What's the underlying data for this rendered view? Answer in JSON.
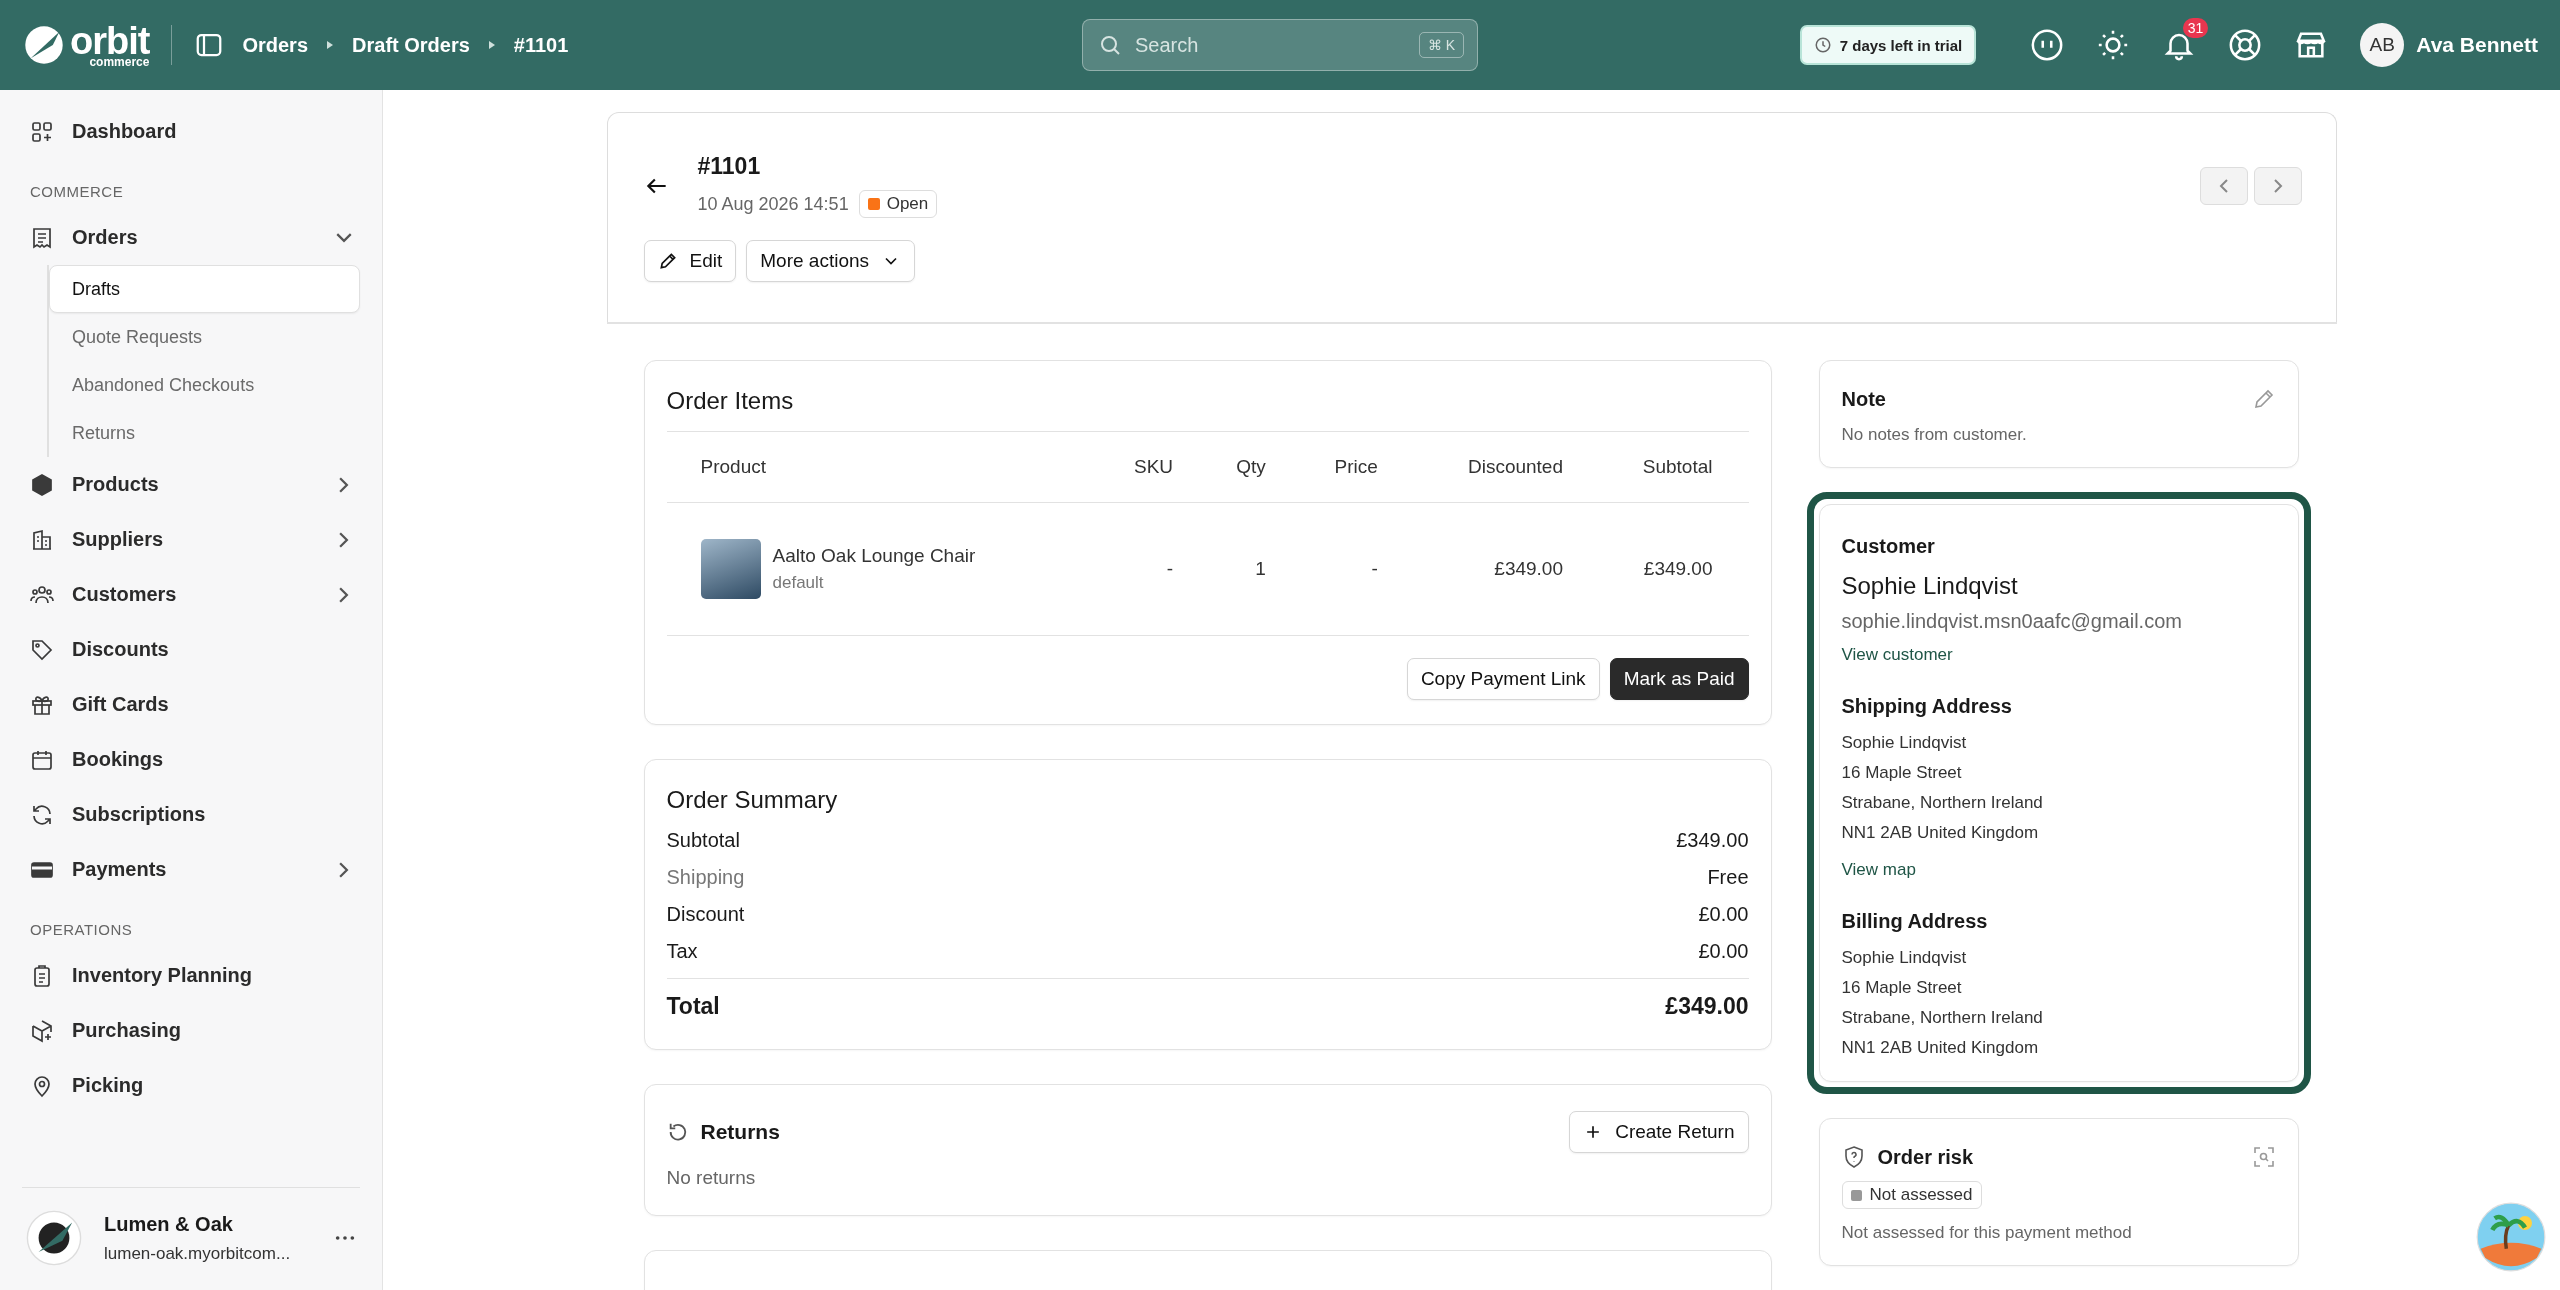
{
  "topbar": {
    "logo": {
      "word": "orbit",
      "sub": "commerce"
    },
    "breadcrumbs": [
      "Orders",
      "Draft Orders",
      "#1101"
    ],
    "search": {
      "placeholder": "Search",
      "shortcut": "⌘ K"
    },
    "trial": "7 days left in trial",
    "notifications": "31",
    "user": {
      "initials": "AB",
      "name": "Ava Bennett"
    }
  },
  "sidebar": {
    "items": [
      {
        "kind": "link",
        "label": "Dashboard"
      },
      {
        "kind": "section",
        "label": "COMMERCE"
      },
      {
        "kind": "link",
        "label": "Orders",
        "expanded": true,
        "children": [
          {
            "label": "Drafts",
            "selected": true
          },
          {
            "label": "Quote Requests",
            "selected": false
          },
          {
            "label": "Abandoned Checkouts",
            "selected": false
          },
          {
            "label": "Returns",
            "selected": false
          }
        ]
      },
      {
        "kind": "link",
        "label": "Products",
        "expanded": false
      },
      {
        "kind": "link",
        "label": "Suppliers",
        "expanded": false
      },
      {
        "kind": "link",
        "label": "Customers",
        "expanded": false
      },
      {
        "kind": "link",
        "label": "Discounts"
      },
      {
        "kind": "link",
        "label": "Gift Cards"
      },
      {
        "kind": "link",
        "label": "Bookings"
      },
      {
        "kind": "link",
        "label": "Subscriptions"
      },
      {
        "kind": "link",
        "label": "Payments",
        "expanded": false
      },
      {
        "kind": "section",
        "label": "OPERATIONS"
      },
      {
        "kind": "link",
        "label": "Inventory Planning"
      },
      {
        "kind": "link",
        "label": "Purchasing"
      },
      {
        "kind": "link",
        "label": "Picking"
      }
    ],
    "store": {
      "name": "Lumen & Oak",
      "url": "lumen-oak.myorbitcom..."
    }
  },
  "header": {
    "title": "#1101",
    "date": "10 Aug 2026 14:51",
    "status": {
      "label": "Open",
      "color": "#f97316"
    },
    "actions": [
      "Edit",
      "More actions"
    ]
  },
  "order_items": {
    "title": "Order Items",
    "columns": [
      "Product",
      "SKU",
      "Qty",
      "Price",
      "Discounted",
      "Subtotal"
    ],
    "rows": [
      {
        "name": "Aalto Oak Lounge Chair",
        "variant": "default",
        "sku": "-",
        "qty": "1",
        "price": "-",
        "discounted": "£349.00",
        "subtotal": "£349.00"
      }
    ],
    "buttons": [
      {
        "label": "Copy Payment Link",
        "kind": "secondary"
      },
      {
        "label": "Mark as Paid",
        "kind": "primary"
      }
    ]
  },
  "order_summary": {
    "title": "Order Summary",
    "rows": [
      {
        "label": "Subtotal",
        "value": "£349.00",
        "muted": false
      },
      {
        "label": "Shipping",
        "value": "Free",
        "muted": true
      },
      {
        "label": "Discount",
        "value": "£0.00",
        "muted": false
      },
      {
        "label": "Tax",
        "value": "£0.00",
        "muted": false
      }
    ],
    "total": {
      "label": "Total",
      "value": "£349.00"
    }
  },
  "returns": {
    "title": "Returns",
    "button": "Create Return",
    "empty": "No returns"
  },
  "note": {
    "title": "Note",
    "text": "No notes from customer."
  },
  "customer": {
    "highlighted": true,
    "title": "Customer",
    "name": "Sophie Lindqvist",
    "email": "sophie.lindqvist.msn0aafc@gmail.com",
    "link": "View customer",
    "shipping": {
      "title": "Shipping Address",
      "lines": [
        "Sophie Lindqvist",
        "16 Maple Street",
        "Strabane, Northern Ireland",
        "NN1 2AB United Kingdom"
      ],
      "link": "View map"
    },
    "billing": {
      "title": "Billing Address",
      "lines": [
        "Sophie Lindqvist",
        "16 Maple Street",
        "Strabane, Northern Ireland",
        "NN1 2AB United Kingdom"
      ]
    }
  },
  "order_risk": {
    "title": "Order risk",
    "badge": "Not assessed",
    "text": "Not assessed for this payment method"
  }
}
